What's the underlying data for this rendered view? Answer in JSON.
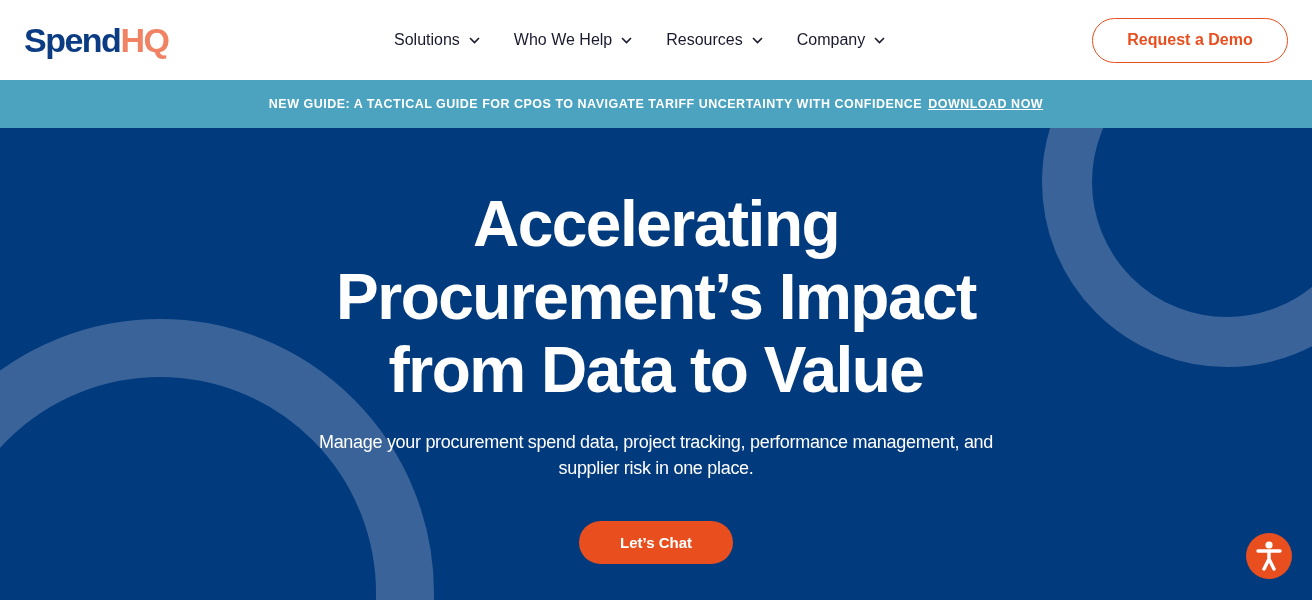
{
  "header": {
    "logo": {
      "part_1": "Spend",
      "part_2": "HQ"
    },
    "nav": [
      {
        "label": "Solutions"
      },
      {
        "label": "Who We Help"
      },
      {
        "label": "Resources"
      },
      {
        "label": "Company"
      }
    ],
    "cta": "Request a Demo"
  },
  "banner": {
    "text": "NEW GUIDE: A TACTICAL GUIDE FOR CPOS TO NAVIGATE TARIFF UNCERTAINTY WITH CONFIDENCE",
    "link": "DOWNLOAD NOW"
  },
  "hero": {
    "title": [
      "Accelerating",
      "Procurement’s Impact",
      "from Data to Value"
    ],
    "subtitle": "Manage your procurement spend data, project tracking, performance management, and supplier risk in one place.",
    "button": "Let’s Chat"
  }
}
